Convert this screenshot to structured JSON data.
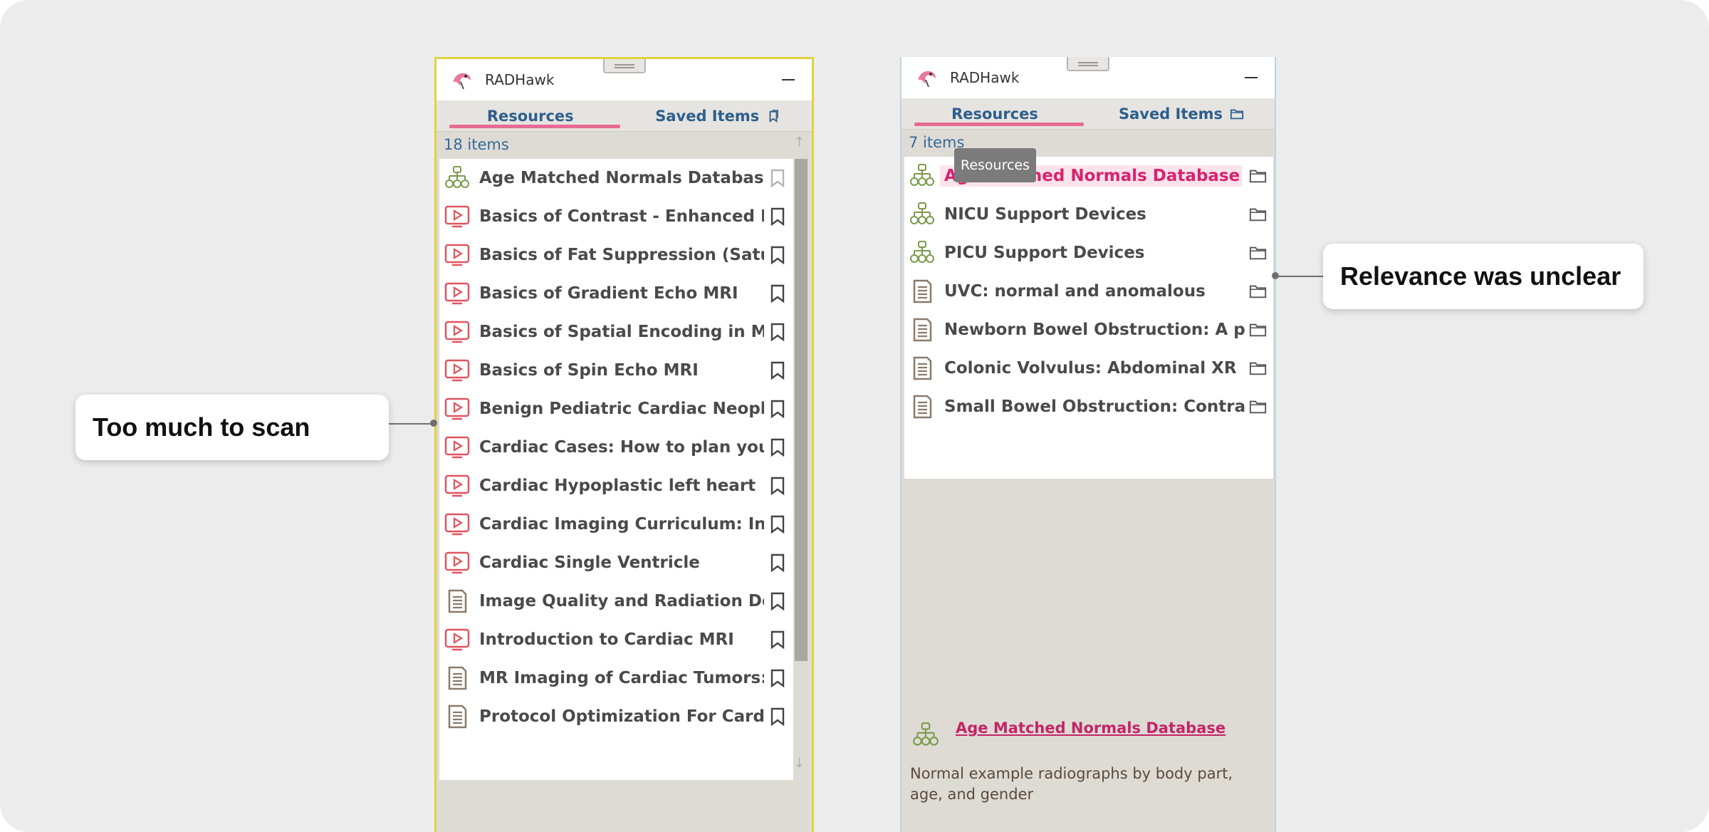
{
  "callouts": {
    "left": "Too much to scan",
    "right": "Relevance was unclear"
  },
  "left_panel": {
    "app_title": "RADHawk",
    "tabs": {
      "resources": "Resources",
      "saved": "Saved Items"
    },
    "count": "18 items",
    "items": [
      {
        "label": "Age Matched Normals Database",
        "icon": "database-icon",
        "action": "bookmark-icon",
        "action_state": "faded"
      },
      {
        "label": "Basics of Contrast - Enhanced MR A",
        "icon": "video-icon",
        "action": "bookmark-icon"
      },
      {
        "label": "Basics of Fat Suppression (Saturati",
        "icon": "video-icon",
        "action": "bookmark-icon"
      },
      {
        "label": "Basics of Gradient Echo MRI",
        "icon": "video-icon",
        "action": "bookmark-icon"
      },
      {
        "label": "Basics of Spatial Encoding in MRI",
        "icon": "video-icon",
        "action": "bookmark-icon"
      },
      {
        "label": "Basics of Spin Echo MRI",
        "icon": "video-icon",
        "action": "bookmark-icon"
      },
      {
        "label": "Benign Pediatric Cardiac Neoplasm:",
        "icon": "video-icon",
        "action": "bookmark-icon"
      },
      {
        "label": "Cardiac Cases: How to plan your exa",
        "icon": "video-icon",
        "action": "bookmark-icon"
      },
      {
        "label": "Cardiac Hypoplastic left heart",
        "icon": "video-icon",
        "action": "bookmark-icon"
      },
      {
        "label": "Cardiac Imaging Curriculum: Introdu",
        "icon": "video-icon",
        "action": "bookmark-icon"
      },
      {
        "label": "Cardiac Single Ventricle",
        "icon": "video-icon",
        "action": "bookmark-icon"
      },
      {
        "label": "Image Quality and Radiation Dose o",
        "icon": "document-icon",
        "action": "bookmark-icon"
      },
      {
        "label": "Introduction to Cardiac MRI",
        "icon": "video-icon",
        "action": "bookmark-icon"
      },
      {
        "label": "MR Imaging of Cardiac Tumors: Met",
        "icon": "document-icon",
        "action": "bookmark-icon"
      },
      {
        "label": "Protocol Optimization For Cardiac A",
        "icon": "document-icon",
        "action": "bookmark-icon"
      }
    ]
  },
  "right_panel": {
    "app_title": "RADHawk",
    "tabs": {
      "resources": "Resources",
      "saved": "Saved Items"
    },
    "count": "7 items",
    "tooltip": "Resources",
    "items": [
      {
        "label": "Age Matched Normals Database",
        "icon": "database-icon",
        "action": "folder-icon",
        "highlighted": true
      },
      {
        "label": "NICU Support Devices",
        "icon": "database-icon",
        "action": "folder-icon"
      },
      {
        "label": "PICU Support Devices",
        "icon": "database-icon",
        "action": "folder-icon"
      },
      {
        "label": "UVC: normal and anomalous",
        "icon": "document-icon",
        "action": "folder-icon"
      },
      {
        "label": "Newborn Bowel Obstruction: A patt...",
        "icon": "document-icon",
        "action": "folder-icon"
      },
      {
        "label": "Colonic Volvulus: Abdominal XR",
        "icon": "document-icon",
        "action": "folder-icon"
      },
      {
        "label": "Small Bowel Obstruction: Contrast C...",
        "icon": "document-icon",
        "action": "folder-icon"
      }
    ],
    "detail": {
      "title": "Age Matched Normals Database",
      "description": "Normal example radiographs by body part, age, and gender",
      "icon": "database-icon"
    }
  },
  "colors": {
    "accent_pink": "#e66b94",
    "link_magenta": "#c42468",
    "tab_blue": "#2d5f8e",
    "video_red": "#e05560",
    "database_green": "#7a9a4a",
    "document_brown": "#8a7a6a",
    "left_border_yellow": "#e2d23e"
  }
}
